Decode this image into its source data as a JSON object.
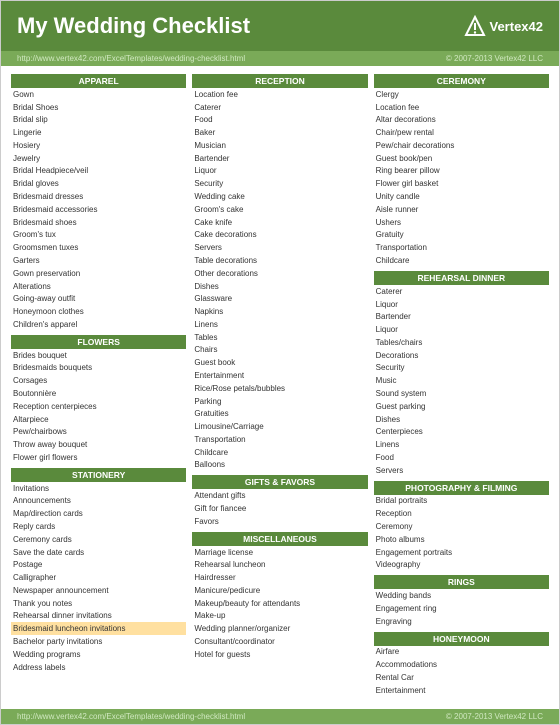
{
  "header": {
    "title": "My Wedding Checklist",
    "logo_text": "Vertex42",
    "url_left": "http://www.vertex42.com/ExcelTemplates/wedding-checklist.html",
    "url_right": "© 2007-2013 Vertex42 LLC",
    "footer_url_left": "http://www.vertex42.com/ExcelTemplates/wedding-checklist.html",
    "footer_url_right": "© 2007-2013 Vertex42 LLC"
  },
  "columns": [
    {
      "sections": [
        {
          "header": "APPAREL",
          "items": [
            "Gown",
            "Bridal Shoes",
            "Bridal slip",
            "Lingerie",
            "Hosiery",
            "Jewelry",
            "Bridal Headpiece/veil",
            "Bridal gloves",
            "Bridesmaid dresses",
            "Bridesmaid accessories",
            "Bridesmaid shoes",
            "Groom's tux",
            "Groomsmen tuxes",
            "Garters",
            "Gown preservation",
            "Alterations",
            "Going-away outfit",
            "Honeymoon clothes",
            "Children's apparel"
          ]
        },
        {
          "header": "FLOWERS",
          "items": [
            "Brides bouquet",
            "Bridesmaids bouquets",
            "Corsages",
            "Boutonnière",
            "Reception centerpieces",
            "Altarpiece",
            "Pew/chairbows",
            "Throw away bouquet",
            "Flower girl flowers"
          ]
        },
        {
          "header": "STATIONERY",
          "items": [
            "Invitations",
            "Announcements",
            "Map/direction cards",
            "Reply cards",
            "Ceremony cards",
            "Save the date cards",
            "Postage",
            "Calligrapher",
            "Newspaper announcement",
            "Thank you notes",
            "Rehearsal dinner invitations",
            "Bridesmaid luncheon invitations",
            "Bachelor party invitations",
            "Wedding programs",
            "Address labels"
          ]
        }
      ]
    },
    {
      "sections": [
        {
          "header": "RECEPTION",
          "items": [
            "Location fee",
            "Caterer",
            "Food",
            "Baker",
            "Musician",
            "Bartender",
            "Liquor",
            "Security",
            "Wedding cake",
            "Groom's cake",
            "Cake knife",
            "Cake decorations",
            "Servers",
            "Table decorations",
            "Other decorations",
            "Dishes",
            "Glassware",
            "Napkins",
            "Linens",
            "Tables",
            "Chairs",
            "Guest book",
            "Entertainment",
            "Rice/Rose petals/bubbles",
            "Parking",
            "Gratuities",
            "Limousine/Carriage",
            "Transportation",
            "Childcare",
            "Balloons"
          ]
        },
        {
          "header": "GIFTS & FAVORS",
          "items": [
            "Attendant gifts",
            "Gift for fiancee",
            "Favors"
          ]
        },
        {
          "header": "MISCELLANEOUS",
          "items": [
            "Marriage license",
            "Rehearsal luncheon",
            "Hairdresser",
            "Manicure/pedicure",
            "Makeup/beauty for attendants",
            "Make-up",
            "Wedding planner/organizer",
            "Consultant/coordinator",
            "Hotel for guests"
          ]
        }
      ]
    },
    {
      "sections": [
        {
          "header": "CEREMONY",
          "items": [
            "Clergy",
            "Location fee",
            "Altar decorations",
            "Chair/pew rental",
            "Pew/chair decorations",
            "Guest book/pen",
            "Ring bearer pillow",
            "Flower girl basket",
            "Unity candle",
            "Aisle runner",
            "Ushers",
            "Gratuity",
            "Transportation",
            "Childcare"
          ]
        },
        {
          "header": "REHEARSAL DINNER",
          "items": [
            "Caterer",
            "Liquor",
            "Bartender",
            "Liquor",
            "Tables/chairs",
            "Decorations",
            "Security",
            "Music",
            "Sound system",
            "Guest parking",
            "Dishes",
            "Centerpieces",
            "Linens",
            "Food",
            "Servers"
          ]
        },
        {
          "header": "PHOTOGRAPHY & FILMING",
          "items": [
            "Bridal portraits",
            "Reception",
            "Ceremony",
            "Photo albums",
            "Engagement portraits",
            "Videography"
          ]
        },
        {
          "header": "RINGS",
          "items": [
            "Wedding bands",
            "Engagement ring",
            "Engraving"
          ]
        },
        {
          "header": "HONEYMOON",
          "items": [
            "Airfare",
            "Accommodations",
            "Rental Car",
            "Entertainment"
          ]
        }
      ]
    }
  ]
}
